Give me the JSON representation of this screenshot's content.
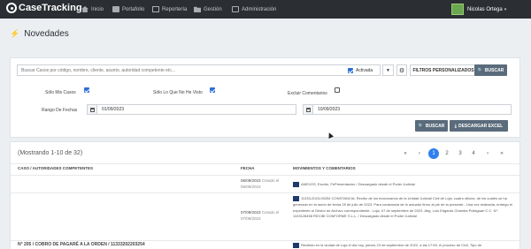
{
  "navbar": {
    "brand": "CaseTracking",
    "items": [
      {
        "label": "Inicio",
        "icon": "home-icon"
      },
      {
        "label": "Portafolio",
        "icon": "briefcase-icon"
      },
      {
        "label": "Reportería",
        "icon": "chart-icon"
      },
      {
        "label": "Gestión",
        "icon": "folder-icon"
      },
      {
        "label": "Administración",
        "icon": "admin-icon"
      }
    ],
    "user": "Nicolas Ortega"
  },
  "page": {
    "title": "Novedades"
  },
  "filters": {
    "search_placeholder": "Buscar Casos por código, nombre, cliente, asunto, autoridad competente etc...",
    "activada_label": "Activada",
    "activada_checked": true,
    "personalizados_label": "FILTROS PERSONALIZADOS",
    "buscar_top_label": "BUSCAR",
    "solo_mis_casos": {
      "label": "Sólo Mis Casos",
      "checked": true
    },
    "solo_no_visto": {
      "label": "Sólo Lo Que No He Visto",
      "checked": true
    },
    "excluir_comentarios": {
      "label": "Excluir Comentarios",
      "checked": false
    },
    "rango_label": "Rango De Fechas",
    "date_from": "01/09/2023",
    "date_to": "10/09/2023",
    "buscar_label": "BUSCAR",
    "descargar_label": "DESCARGAR EXCEL"
  },
  "results": {
    "count_text": "(Mostrando 1-10 de 32)",
    "pagination": [
      "«",
      "‹",
      "1",
      "2",
      "3",
      "4",
      "›",
      "»"
    ],
    "active_page": "1",
    "columns": {
      "caso": "CASO / AUTORIDADES COMPETENTES",
      "fecha": "FECHA",
      "movimientos": "MOVIMIENTOS Y COMENTARIOS"
    },
    "rows": [
      {
        "fecha": "06/09/2023",
        "creado": "Creado el",
        "creado_fecha": "06/09/2023",
        "movimiento": "ANEXOS, Escrito, FePresentacion / Descargado desde el Poder Judicial"
      },
      {
        "fecha": "07/09/2023",
        "creado": "Creado el",
        "creado_fecha": "07/09/2023",
        "movimiento": "11333-2023-00254 CONSTANCIA: Recibo de los funcionarios de la Unidad Judicial Civil de Loja, cuatro oficios; de los cuales se ha generado en la razón de fecha 25 de julio de 2023. Para constancia de lo actuado firmo al pie de la presente.- Una vez realizada, entrego el expediente al Gestor de Archivo correspondiente.- Loja, 07 de septiembre de 2023. Abg. Luis Edgardo Chamba Pullaguari C.C. N°: 1103128458 RECIBI CONFORME S.L.L. / Descargado desde el Poder Judicial"
      }
    ],
    "case_title": "N° 205 / COBRO DE PAGARÉ A LA ORDEN / 11333202203254",
    "last_movement": "Recibido en la ciudad de Loja el día hoy, jueves 23 de septiembre de 2022, a las 17:50, el proceso de Civil, Tipo de"
  }
}
